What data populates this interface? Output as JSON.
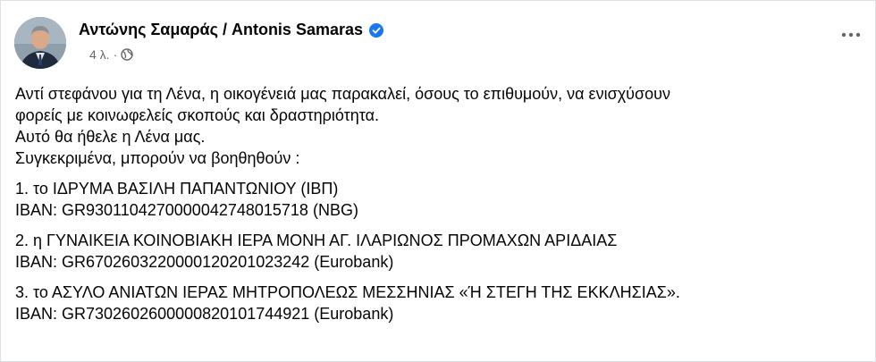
{
  "post": {
    "author": "Αντώνης Σαμαράς / Antonis Samaras",
    "time": "4 λ.",
    "separator": "·",
    "icons": {
      "verified": "verified-badge-icon",
      "privacy": "globe-icon",
      "more": "more-options-icon"
    },
    "accent_color": "#1877f2",
    "intro_lines": [
      "Αντί στεφάνου για τη Λένα, η οικογένειά μας παρακαλεί,  όσους το επιθυμούν, να ενισχύσουν",
      "φορείς με κοινωφελείς σκοπούς και δραστηριότητα.",
      "Αυτό θα ήθελε  η Λένα μας.",
      "Συγκεκριμένα, μπορούν να βοηθηθούν :"
    ],
    "items": [
      {
        "name": "1. το ΙΔΡΥΜΑ ΒΑΣΙΛΗ ΠΑΠΑΝΤΩΝΙΟΥ  (ΙΒΠ)",
        "iban": "IBAN: GR9301104270000042748015718 (NBG)"
      },
      {
        "name": "2. η ΓΥΝΑΙΚΕΙΑ ΚΟΙΝΟΒΙΑΚΗ ΙΕΡΑ ΜΟΝΗ ΑΓ. ΙΛΑΡΙΩΝΟΣ ΠΡΟΜΑΧΩΝ ΑΡΙΔΑΙΑΣ",
        "iban": "IBAN: GR6702603220000120201023242 (Eurobank)"
      },
      {
        "name": "3. το ΑΣΥΛΟ ΑΝΙΑΤΩΝ ΙΕΡΑΣ ΜΗΤΡΟΠΟΛΕΩΣ ΜΕΣΣΗΝΙΑΣ «Ή ΣΤΕΓΗ ΤΗΣ ΕΚΚΛΗΣΙΑΣ».",
        "iban": "IBAN: GR7302602600000820101744921 (Eurobank)"
      }
    ]
  }
}
